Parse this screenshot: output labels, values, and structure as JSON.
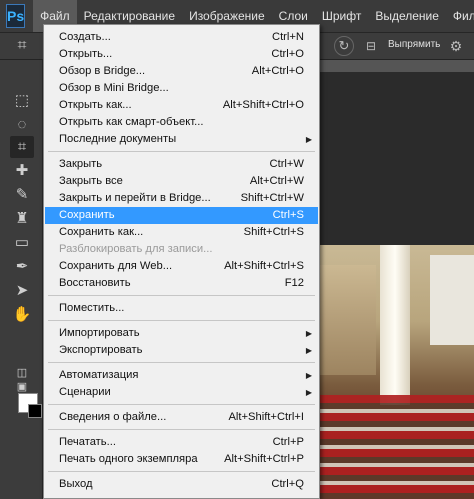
{
  "menubar": {
    "logo": "Ps",
    "items": [
      "Файл",
      "Редактирование",
      "Изображение",
      "Слои",
      "Шрифт",
      "Выделение",
      "Фильтр"
    ]
  },
  "options": {
    "straighten_label": "Выпрямить"
  },
  "menu": {
    "items": [
      {
        "label": "Создать...",
        "shortcut": "Ctrl+N"
      },
      {
        "label": "Открыть...",
        "shortcut": "Ctrl+O"
      },
      {
        "label": "Обзор в Bridge...",
        "shortcut": "Alt+Ctrl+O"
      },
      {
        "label": "Обзор в Mini Bridge...",
        "shortcut": ""
      },
      {
        "label": "Открыть как...",
        "shortcut": "Alt+Shift+Ctrl+O"
      },
      {
        "label": "Открыть как смарт-объект...",
        "shortcut": ""
      },
      {
        "label": "Последние документы",
        "shortcut": ""
      },
      {
        "label": "Закрыть",
        "shortcut": "Ctrl+W"
      },
      {
        "label": "Закрыть все",
        "shortcut": "Alt+Ctrl+W"
      },
      {
        "label": "Закрыть и перейти в Bridge...",
        "shortcut": "Shift+Ctrl+W"
      },
      {
        "label": "Сохранить",
        "shortcut": "Ctrl+S"
      },
      {
        "label": "Сохранить как...",
        "shortcut": "Shift+Ctrl+S"
      },
      {
        "label": "Разблокировать для записи...",
        "shortcut": ""
      },
      {
        "label": "Сохранить для Web...",
        "shortcut": "Alt+Shift+Ctrl+S"
      },
      {
        "label": "Восстановить",
        "shortcut": "F12"
      },
      {
        "label": "Поместить...",
        "shortcut": ""
      },
      {
        "label": "Импортировать",
        "shortcut": ""
      },
      {
        "label": "Экспортировать",
        "shortcut": ""
      },
      {
        "label": "Автоматизация",
        "shortcut": ""
      },
      {
        "label": "Сценарии",
        "shortcut": ""
      },
      {
        "label": "Сведения о файле...",
        "shortcut": "Alt+Shift+Ctrl+I"
      },
      {
        "label": "Печатать...",
        "shortcut": "Ctrl+P"
      },
      {
        "label": "Печать одного экземпляра",
        "shortcut": "Alt+Shift+Ctrl+P"
      },
      {
        "label": "Выход",
        "shortcut": "Ctrl+Q"
      }
    ]
  },
  "colors": {
    "highlight": "#3399ff",
    "menu_bg": "#f0f0f0",
    "app_bg": "#3a3a3a"
  }
}
